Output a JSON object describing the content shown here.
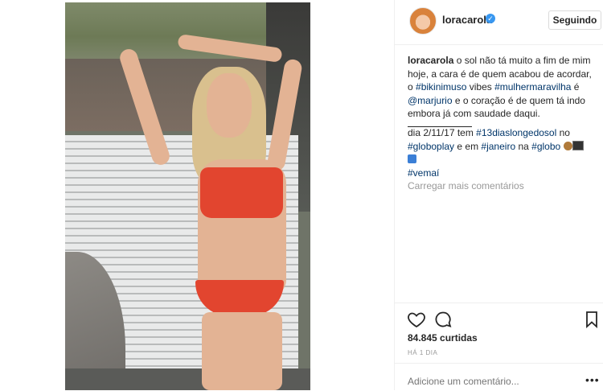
{
  "post": {
    "username": "loracarola",
    "follow_label": "Seguindo",
    "caption_parts": {
      "p1": " o sol não tá muito a fim de mim hoje, a cara é de quem acabou de acordar, o ",
      "tag1": "#bikinimuso",
      "p2": " vibes ",
      "tag2": "#mulhermaravilha",
      "p3": " é ",
      "tag3": "@marjurio",
      "p4": " e o coração é de quem tá indo embora já com saudade daqui."
    },
    "caption2_parts": {
      "p1": "dia 2/11/17 tem ",
      "tag1": "#13diaslongedosol",
      "p2": " no ",
      "tag2": "#globoplay",
      "p3": " e em ",
      "tag3": "#janeiro",
      "p4": " na ",
      "tag4": "#globo",
      "tag5": "#vemaí"
    },
    "load_more": "Carregar mais comentários",
    "likes": "84.845 curtidas",
    "time": "HÁ 1 DIA",
    "comment_placeholder": "Adicione um comentário...",
    "more": "•••"
  },
  "icons": {
    "like": "heart-icon",
    "comment": "comment-icon",
    "save": "bookmark-icon",
    "verified": "verified-badge-icon"
  },
  "colors": {
    "link": "#003569",
    "verified": "#3897f0",
    "muted": "#999999",
    "text": "#262626"
  }
}
